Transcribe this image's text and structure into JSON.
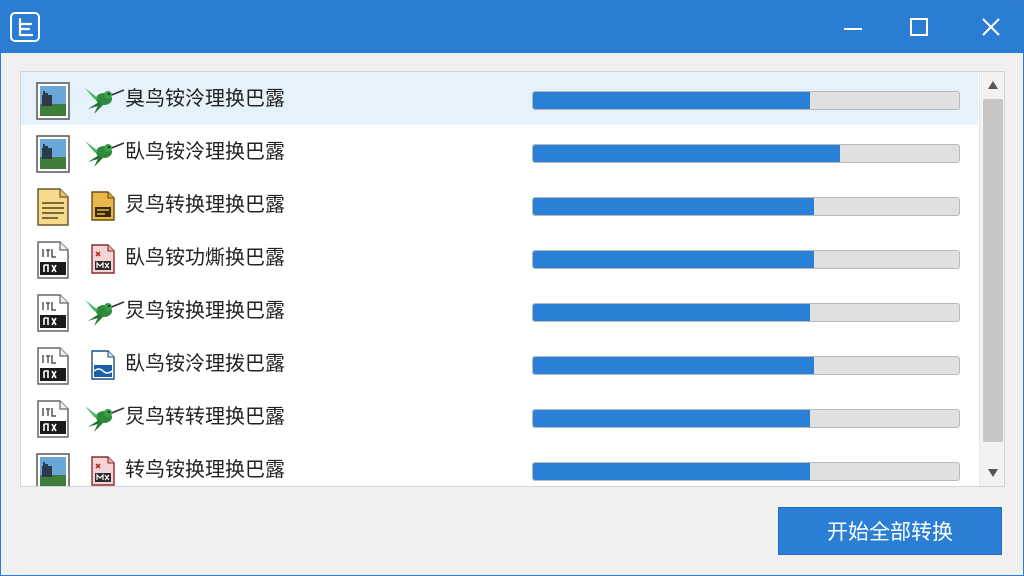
{
  "window": {
    "icons": {
      "app": "app-logo-icon",
      "minimize": "minimize-icon",
      "maximize": "maximize-icon",
      "close": "close-icon"
    }
  },
  "file_list": {
    "items": [
      {
        "label": "臭鸟铵泠理换巴露",
        "file_icon": "image-file-icon",
        "app_icon": "hummingbird-icon",
        "progress": 0.65,
        "selected": true
      },
      {
        "label": "臥鸟铵泠理换巴露",
        "file_icon": "image-file-icon",
        "app_icon": "hummingbird-icon",
        "progress": 0.72,
        "selected": false
      },
      {
        "label": "炅鸟转换理换巴露",
        "file_icon": "text-document-icon",
        "app_icon": "yellow-document-icon",
        "progress": 0.66,
        "selected": false
      },
      {
        "label": "臥鸟铵功燍换巴露",
        "file_icon": "media-file-icon",
        "app_icon": "red-document-icon",
        "progress": 0.66,
        "selected": false
      },
      {
        "label": "炅鸟铵换理换巴露",
        "file_icon": "media-file-icon",
        "app_icon": "hummingbird-icon",
        "progress": 0.65,
        "selected": false
      },
      {
        "label": "臥鸟铵泠理拨巴露",
        "file_icon": "media-file-icon",
        "app_icon": "blue-document-icon",
        "progress": 0.66,
        "selected": false
      },
      {
        "label": "炅鸟转转理换巴露",
        "file_icon": "media-file-icon",
        "app_icon": "hummingbird-icon",
        "progress": 0.65,
        "selected": false
      },
      {
        "label": "转鸟铵换理换巴露",
        "file_icon": "image-file-icon",
        "app_icon": "red-document-icon",
        "progress": 0.65,
        "selected": false
      }
    ]
  },
  "scrollbar": {
    "up_icon": "scroll-up-arrow-icon",
    "down_icon": "scroll-down-arrow-icon"
  },
  "actions": {
    "convert_all_label": "开始全部转换"
  },
  "colors": {
    "title_bar": "#2b7dd4",
    "accent": "#2a80d6",
    "selected_row": "#e5f1fb",
    "track": "#e0e0e0"
  }
}
